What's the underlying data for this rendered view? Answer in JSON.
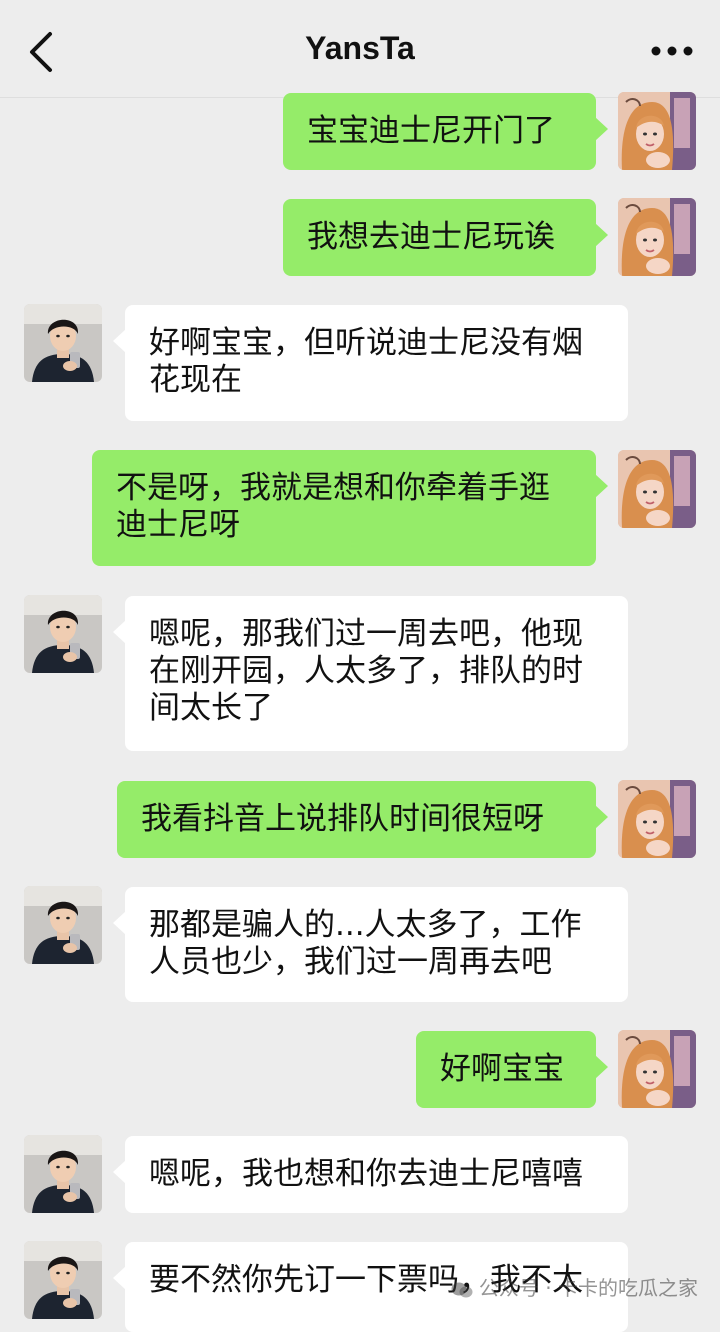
{
  "header": {
    "title": "YansTa",
    "back_icon": "chevron-left-icon",
    "more_icon": "more-dots-icon"
  },
  "messages": [
    {
      "side": "sent",
      "text": "宝宝迪士尼开门了"
    },
    {
      "side": "sent",
      "text": "我想去迪士尼玩诶"
    },
    {
      "side": "recv",
      "line1": "好啊宝宝，但听说迪士尼没有烟",
      "line2": "花现在"
    },
    {
      "side": "sent",
      "line1": "不是呀，我就是想和你牵着手逛",
      "line2": "迪士尼呀"
    },
    {
      "side": "recv",
      "line1": "嗯呢，那我们过一周去吧，他现",
      "line2": "在刚开园，人太多了，排队的时",
      "line3": "间太长了"
    },
    {
      "side": "sent",
      "text": "我看抖音上说排队时间很短呀"
    },
    {
      "side": "recv",
      "line1": "那都是骗人的...人太多了，工作",
      "line2": "人员也少，我们过一周再去吧"
    },
    {
      "side": "sent",
      "text": "好啊宝宝"
    },
    {
      "side": "recv",
      "text": "嗯呢，我也想和你去迪士尼嘻嘻"
    },
    {
      "side": "recv",
      "text": "要不然你先订一下票吗，我不太"
    }
  ],
  "watermark": "公众号 · 卡卡的吃瓜之家",
  "colors": {
    "sent_bubble": "#95ec69",
    "recv_bubble": "#ffffff",
    "background": "#ededed"
  }
}
